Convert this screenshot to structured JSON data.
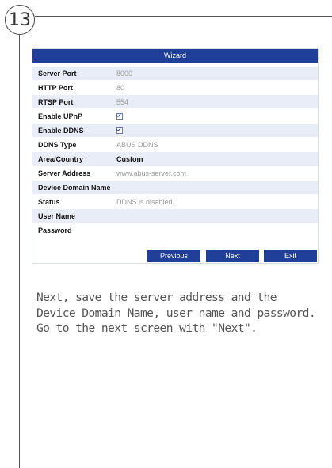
{
  "step_number": "13",
  "wizard": {
    "title": "Wizard",
    "rows": [
      {
        "label": "Server Port",
        "value": "8000"
      },
      {
        "label": "HTTP Port",
        "value": "80"
      },
      {
        "label": "RTSP Port",
        "value": "554"
      },
      {
        "label": "Enable UPnP",
        "checked": true
      },
      {
        "label": "Enable DDNS",
        "checked": true
      },
      {
        "label": "DDNS Type",
        "value": "ABUS DDNS"
      },
      {
        "label": "Area/Country",
        "value": "Custom"
      },
      {
        "label": "Server Address",
        "value": "www.abus-server.com"
      },
      {
        "label": "Device Domain Name",
        "value": ""
      },
      {
        "label": "Status",
        "value": "DDNS is disabled."
      },
      {
        "label": "User Name",
        "value": ""
      },
      {
        "label": "Password",
        "value": ""
      }
    ],
    "buttons": {
      "previous": "Previous",
      "next": "Next",
      "exit": "Exit"
    }
  },
  "caption": "Next, save the server address and the Device Domain Name, user name and password. Go to the next screen with \"Next\"."
}
